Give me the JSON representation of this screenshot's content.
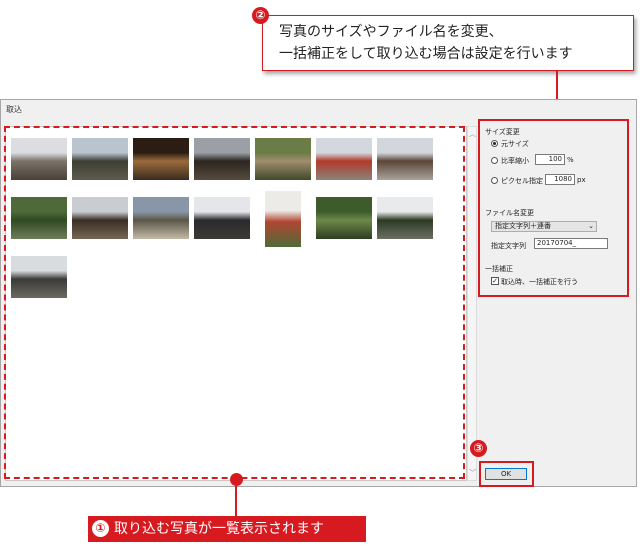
{
  "callouts": {
    "top_number": "②",
    "top_line1": "写真のサイズやファイル名を変更、",
    "top_line2": "一括補正をして取り込む場合は設定を行います",
    "ok_number": "③",
    "bottom_number": "①",
    "bottom_text": "取り込む写真が一覧表示されます"
  },
  "window": {
    "title": "取込"
  },
  "photos": [
    {
      "name": "temple-garden",
      "c1": "#dcdde0",
      "c2": "#7b7268",
      "c3": "#4a4037"
    },
    {
      "name": "temple-roof-trees",
      "c1": "#b9c4cf",
      "c2": "#3b3f32",
      "c3": "#5e5b4e"
    },
    {
      "name": "ornate-gate",
      "c1": "#2b1d14",
      "c2": "#9a6b3c",
      "c3": "#3b2c1e"
    },
    {
      "name": "dark-hall",
      "c1": "#9aa0a6",
      "c2": "#2c2620",
      "c3": "#564a3c"
    },
    {
      "name": "shrine-forest",
      "c1": "#6a7d46",
      "c2": "#a08d6e",
      "c3": "#3f4a2a"
    },
    {
      "name": "red-gate",
      "c1": "#d3d8de",
      "c2": "#b23a2a",
      "c3": "#8a8378"
    },
    {
      "name": "long-hall",
      "c1": "#d2d7dd",
      "c2": "#5b4537",
      "c3": "#a8a39a"
    },
    {
      "name": "garden-pond",
      "c1": "#4e6a38",
      "c2": "#2f4a22",
      "c3": "#6f7d5a"
    },
    {
      "name": "temple-facade",
      "c1": "#c9cdd1",
      "c2": "#3a2e24",
      "c3": "#766754"
    },
    {
      "name": "courtyard-dusk",
      "c1": "#8896a8",
      "c2": "#5b5648",
      "c3": "#c3b9a6"
    },
    {
      "name": "roof-sky",
      "c1": "#e4e6ea",
      "c2": "#2a2a2c",
      "c3": "#3c3a36"
    },
    {
      "name": "red-pagoda",
      "c1": "#ecebe8",
      "c2": "#b14632",
      "c3": "#4e6b38"
    },
    {
      "name": "green-garden",
      "c1": "#3d5b2b",
      "c2": "#6c8a4a",
      "c3": "#2d3e22"
    },
    {
      "name": "veranda",
      "c1": "#e8eaec",
      "c2": "#2d3a22",
      "c3": "#6b6f62"
    },
    {
      "name": "castle-tower",
      "c1": "#d9dcdf",
      "c2": "#3a3a38",
      "c3": "#6c6a60"
    }
  ],
  "panel": {
    "size_title": "サイズ変更",
    "opt_original": "元サイズ",
    "opt_ratio": "比率縮小",
    "ratio_value": "100",
    "ratio_unit": "%",
    "opt_pixel": "ピクセル指定",
    "pixel_value": "1080",
    "pixel_unit": "px",
    "filename_title": "ファイル名変更",
    "filename_select": "指定文字列＋連番",
    "filename_label": "指定文字列",
    "filename_value": "20170704_",
    "correction_title": "一括補正",
    "correction_checkbox": "取込時、一括補正を行う",
    "ok_label": "OK"
  },
  "colors": {
    "accent": "#d71920"
  }
}
